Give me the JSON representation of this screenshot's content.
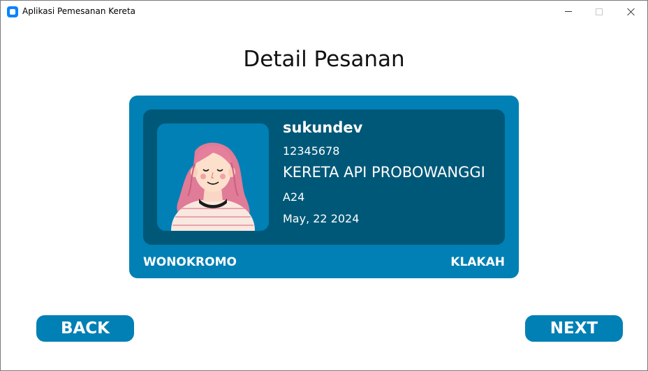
{
  "window": {
    "title": "Aplikasi Pemesanan Kereta",
    "icon": "app-icon",
    "controls": [
      "minimize-icon",
      "maximize-icon",
      "close-icon"
    ]
  },
  "page": {
    "title": "Detail Pesanan"
  },
  "ticket": {
    "username": "sukundev",
    "user_id": "12345678",
    "train_name": "KERETA API PROBOWANGGI",
    "seat": "A24",
    "date": "May, 22 2024",
    "origin": "WONOKROMO",
    "destination": "KLAKAH",
    "avatar": "woman-avatar-illustration"
  },
  "actions": {
    "back_label": "BACK",
    "next_label": "NEXT"
  },
  "colors": {
    "card_outer": "#0080b4",
    "card_inner": "#005878",
    "button": "#0080b4",
    "text_on_card": "#ffffff"
  }
}
